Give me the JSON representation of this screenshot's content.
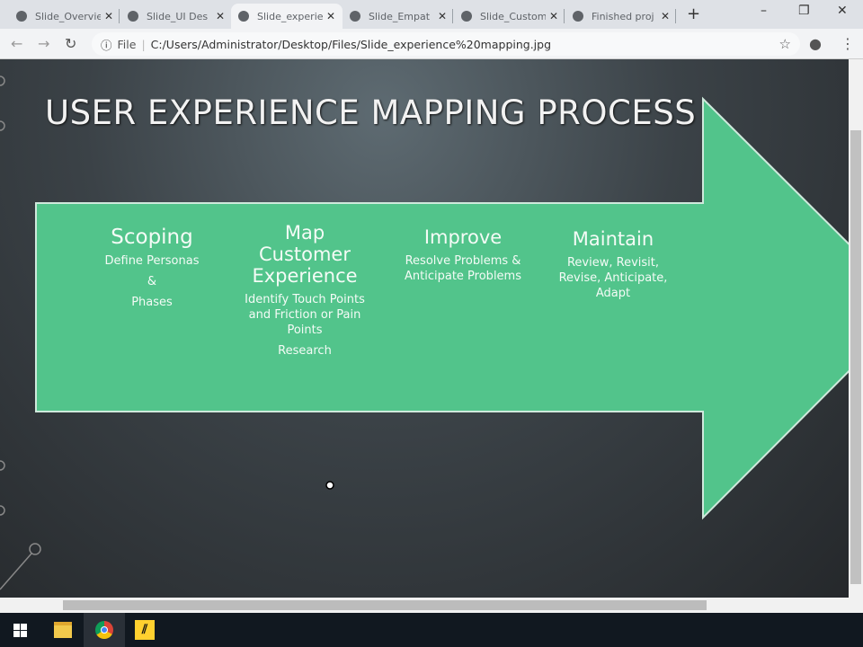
{
  "browser": {
    "tabs": [
      {
        "label": "Slide_Overview"
      },
      {
        "label": "Slide_UI Des"
      },
      {
        "label": "Slide_experience"
      },
      {
        "label": "Slide_Empat"
      },
      {
        "label": "Slide_Custom"
      },
      {
        "label": "Finished proj"
      }
    ],
    "new_tab": "+",
    "minimize": "–",
    "restore": "❐",
    "close": "✕",
    "file_label": "File",
    "url": "C:/Users/Administrator/Desktop/Files/Slide_experience%20mapping.jpg"
  },
  "slide": {
    "title": "USER EXPERIENCE MAPPING PROCESS",
    "accent": "#52c48b",
    "columns": [
      {
        "heading": "Scoping",
        "lines": [
          "Define Personas",
          "&",
          "Phases"
        ]
      },
      {
        "heading": "Map Customer Experience",
        "lines": [
          "Identify Touch Points and Friction or Pain Points",
          "Research"
        ]
      },
      {
        "heading": "Improve",
        "lines": [
          "Resolve Problems & Anticipate Problems"
        ]
      },
      {
        "heading": "Maintain",
        "lines": [
          "Review, Revisit, Revise, Anticipate, Adapt"
        ]
      }
    ]
  }
}
